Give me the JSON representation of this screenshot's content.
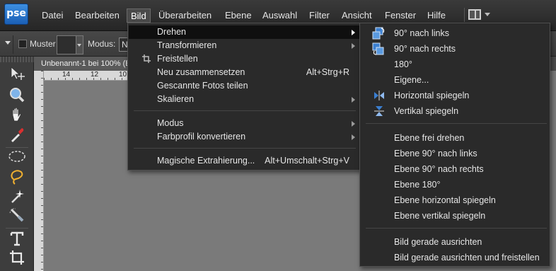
{
  "app": {
    "logo_text": "pse"
  },
  "menubar": {
    "items": [
      {
        "label": "Datei",
        "name": "menu-datei"
      },
      {
        "label": "Bearbeiten",
        "name": "menu-bearbeiten"
      },
      {
        "label": "Bild",
        "name": "menu-bild",
        "active": true
      },
      {
        "label": "Überarbeiten",
        "name": "menu-ueberarbeiten"
      },
      {
        "label": "Ebene",
        "name": "menu-ebene"
      },
      {
        "label": "Auswahl",
        "name": "menu-auswahl"
      },
      {
        "label": "Filter",
        "name": "menu-filter"
      },
      {
        "label": "Ansicht",
        "name": "menu-ansicht"
      },
      {
        "label": "Fenster",
        "name": "menu-fenster"
      },
      {
        "label": "Hilfe",
        "name": "menu-hilfe"
      }
    ],
    "layout_icon": "window-layout-icon"
  },
  "options_bar": {
    "muster_label": "Muster",
    "modus_label": "Modus:",
    "modus_value": "N"
  },
  "document": {
    "tab_title": "Unbenannt-1 bei 100% (E",
    "ruler_ticks": [
      "14",
      "12",
      "10"
    ]
  },
  "toolbox": {
    "tools": [
      "move-tool-icon",
      "zoom-tool-icon",
      "hand-tool-icon",
      "eyedropper-tool-icon",
      "marquee-tool-icon",
      "lasso-tool-icon",
      "magic-wand-tool-icon",
      "selection-brush-tool-icon",
      "text-tool-icon",
      "crop-tool-icon"
    ]
  },
  "bild_menu": {
    "items": [
      {
        "label": "Drehen",
        "submenu": true,
        "active": true
      },
      {
        "label": "Transformieren",
        "submenu": true
      },
      {
        "label": "Freistellen",
        "icon": "crop-icon"
      },
      {
        "label": "Neu zusammensetzen",
        "shortcut": "Alt+Strg+R"
      },
      {
        "label": "Gescannte Fotos teilen"
      },
      {
        "label": "Skalieren",
        "submenu": true
      },
      {
        "label": "Modus",
        "submenu": true
      },
      {
        "label": "Farbprofil konvertieren",
        "submenu": true
      },
      {
        "label": "Magische Extrahierung...",
        "shortcut": "Alt+Umschalt+Strg+V"
      }
    ]
  },
  "drehen_submenu": {
    "items": [
      {
        "label": "90° nach links",
        "icon": "rotate-left-icon"
      },
      {
        "label": "90° nach rechts",
        "icon": "rotate-right-icon"
      },
      {
        "label": "180°"
      },
      {
        "label": "Eigene..."
      },
      {
        "label": "Horizontal spiegeln",
        "icon": "flip-horizontal-icon"
      },
      {
        "label": "Vertikal spiegeln",
        "icon": "flip-vertical-icon"
      },
      {
        "label": "Ebene frei drehen"
      },
      {
        "label": "Ebene 90° nach links"
      },
      {
        "label": "Ebene 90° nach rechts"
      },
      {
        "label": "Ebene 180°"
      },
      {
        "label": "Ebene horizontal spiegeln"
      },
      {
        "label": "Ebene vertikal spiegeln"
      },
      {
        "label": "Bild gerade ausrichten"
      },
      {
        "label": "Bild gerade ausrichten und freistellen"
      }
    ]
  }
}
